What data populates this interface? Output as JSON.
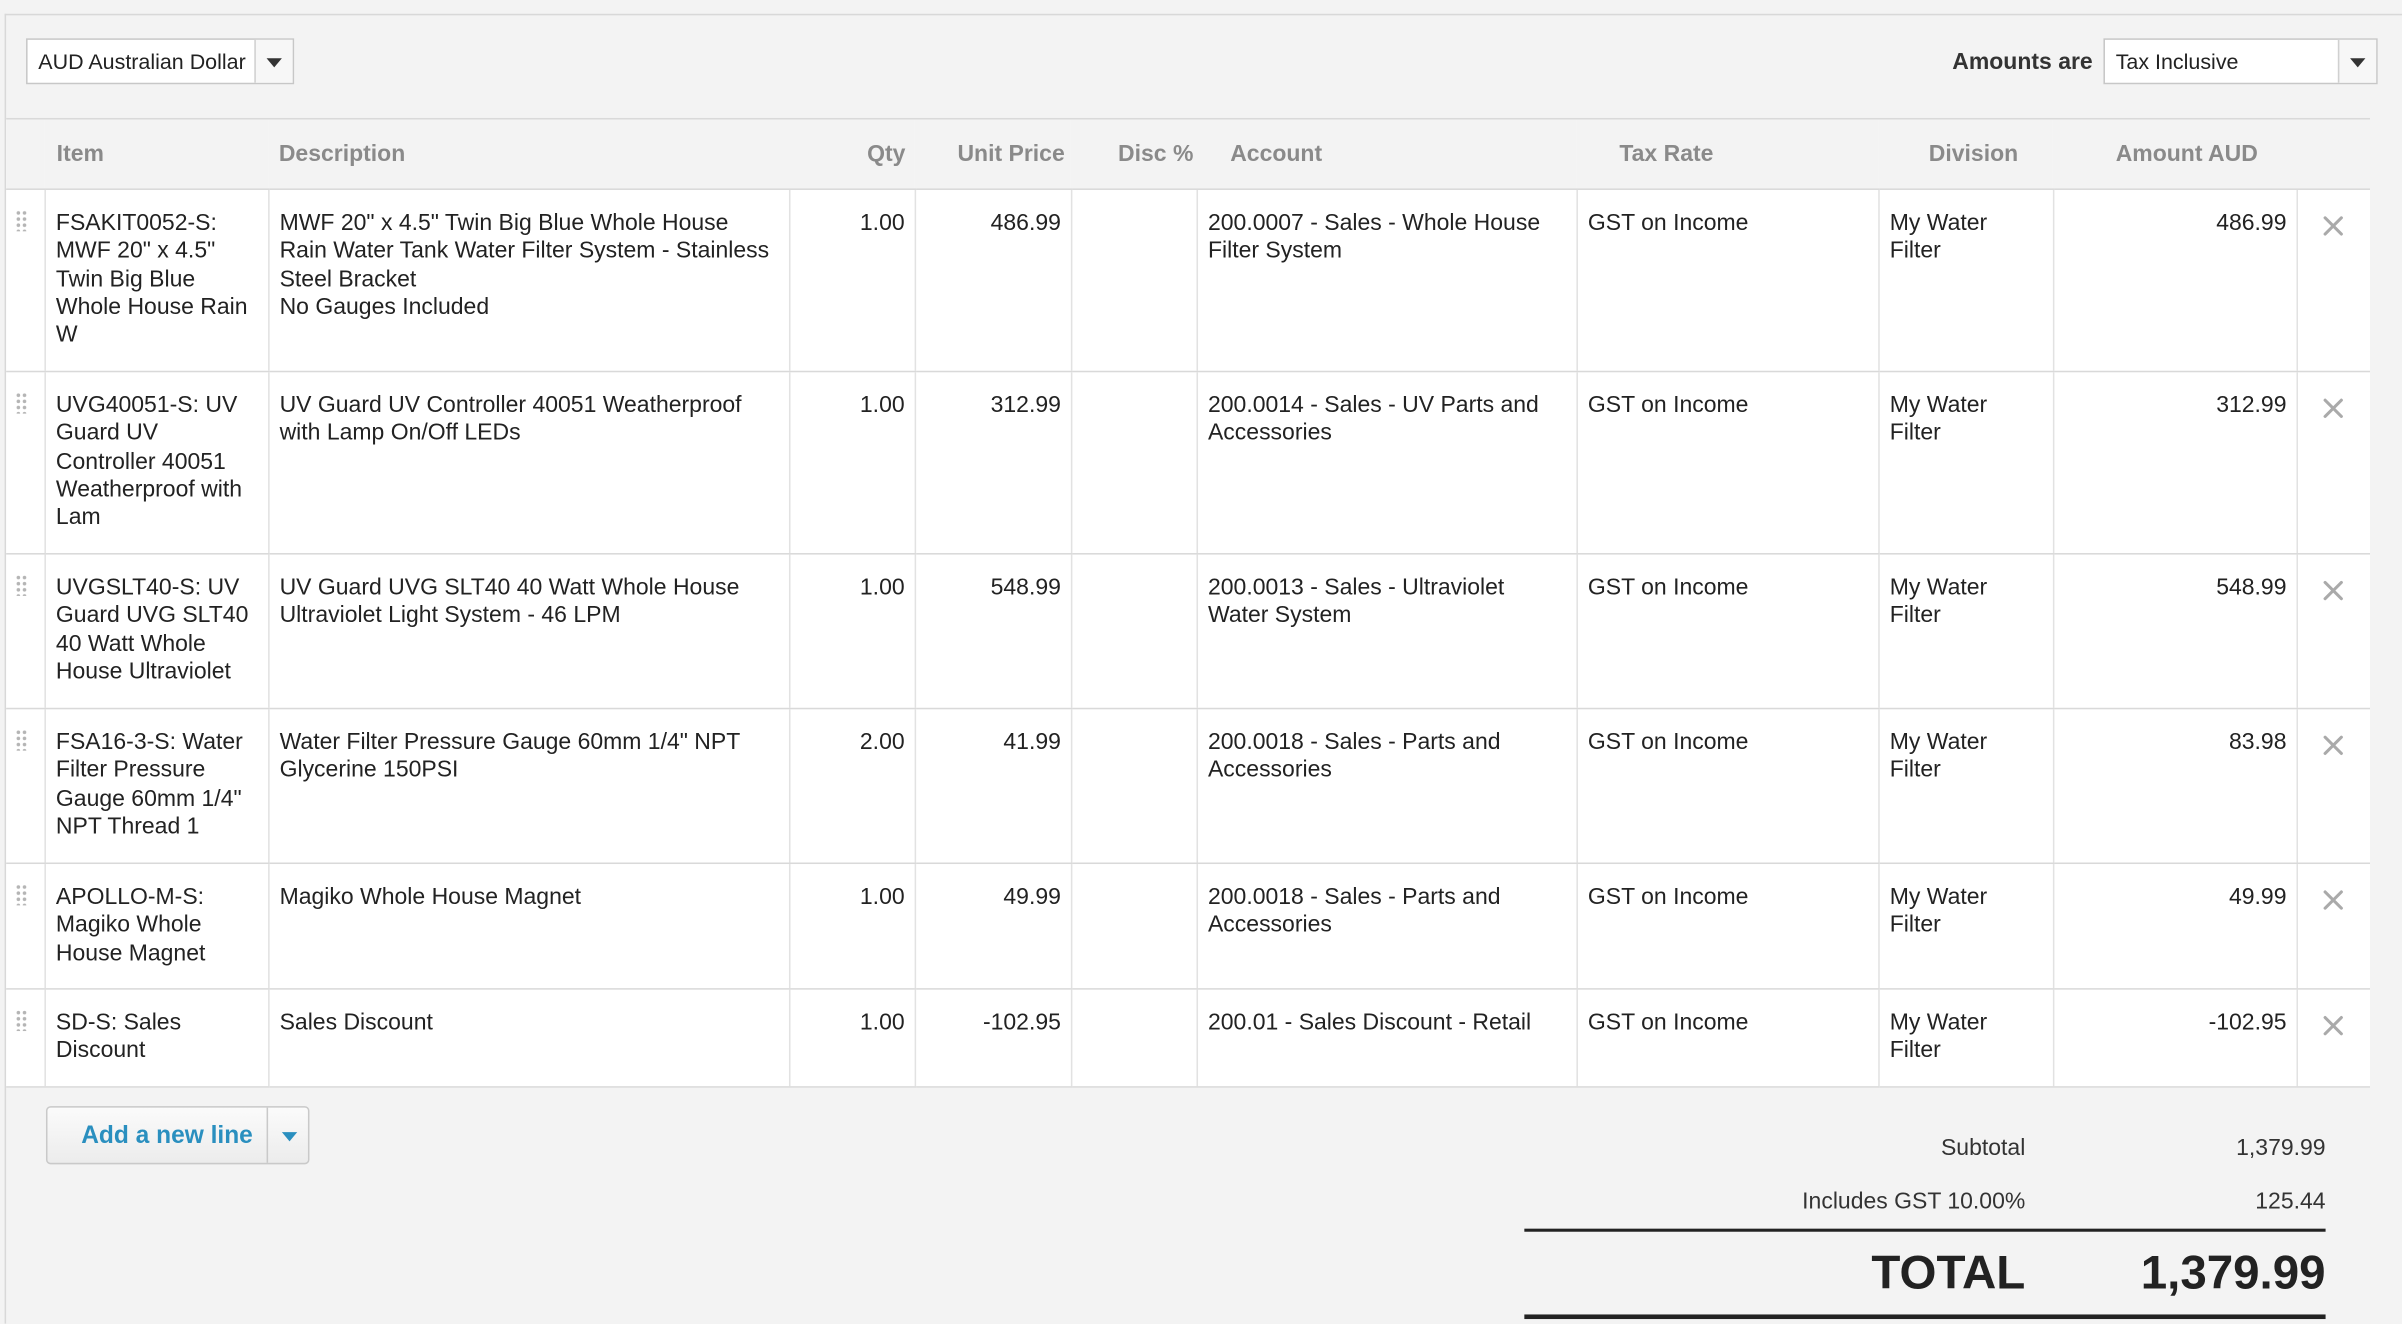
{
  "currency": {
    "selected": "AUD Australian Dollar"
  },
  "amounts": {
    "label": "Amounts are",
    "selected": "Tax Inclusive"
  },
  "columns": {
    "item": "Item",
    "description": "Description",
    "qty": "Qty",
    "unit_price": "Unit Price",
    "disc": "Disc %",
    "account": "Account",
    "tax_rate": "Tax Rate",
    "division": "Division",
    "amount": "Amount AUD"
  },
  "rows": [
    {
      "item": "FSAKIT0052-S: MWF 20\" x 4.5\" Twin Big Blue Whole House Rain W",
      "description": "MWF 20\" x 4.5\" Twin Big Blue Whole House Rain Water Tank Water Filter System - Stainless Steel Bracket\nNo Gauges Included",
      "qty": "1.00",
      "unit_price": "486.99",
      "disc": "",
      "account": "200.0007 - Sales - Whole House Filter System",
      "tax_rate": "GST on Income",
      "division": "My Water Filter",
      "amount": "486.99"
    },
    {
      "item": "UVG40051-S: UV Guard UV Controller 40051 Weatherproof with Lam",
      "description": "UV Guard UV Controller 40051 Weatherproof with Lamp On/Off LEDs",
      "qty": "1.00",
      "unit_price": "312.99",
      "disc": "",
      "account": "200.0014 - Sales - UV Parts and Accessories",
      "tax_rate": "GST on Income",
      "division": "My Water Filter",
      "amount": "312.99"
    },
    {
      "item": "UVGSLT40-S: UV Guard UVG SLT40 40 Watt Whole House Ultraviolet",
      "description": "UV Guard UVG SLT40 40 Watt Whole House Ultraviolet Light System - 46 LPM",
      "qty": "1.00",
      "unit_price": "548.99",
      "disc": "",
      "account": "200.0013 - Sales - Ultraviolet Water System",
      "tax_rate": "GST on Income",
      "division": "My Water Filter",
      "amount": "548.99"
    },
    {
      "item": "FSA16-3-S: Water Filter Pressure Gauge 60mm 1/4\" NPT Thread 1",
      "description": "Water Filter Pressure Gauge 60mm 1/4\" NPT Glycerine 150PSI",
      "qty": "2.00",
      "unit_price": "41.99",
      "disc": "",
      "account": "200.0018 - Sales - Parts and Accessories",
      "tax_rate": "GST on Income",
      "division": "My Water Filter",
      "amount": "83.98"
    },
    {
      "item": "APOLLO-M-S: Magiko Whole House Magnet",
      "description": "Magiko Whole House Magnet",
      "qty": "1.00",
      "unit_price": "49.99",
      "disc": "",
      "account": "200.0018 - Sales - Parts and Accessories",
      "tax_rate": "GST on Income",
      "division": "My Water Filter",
      "amount": "49.99"
    },
    {
      "item": "SD-S: Sales Discount",
      "description": "Sales Discount",
      "qty": "1.00",
      "unit_price": "-102.95",
      "disc": "",
      "account": "200.01 - Sales Discount - Retail",
      "tax_rate": "GST on Income",
      "division": "My Water Filter",
      "amount": "-102.95"
    }
  ],
  "add_line": {
    "label": "Add a new line"
  },
  "totals": {
    "subtotal_label": "Subtotal",
    "subtotal": "1,379.99",
    "gst_label": "Includes GST 10.00%",
    "gst": "125.44",
    "total_label": "TOTAL",
    "total": "1,379.99"
  }
}
